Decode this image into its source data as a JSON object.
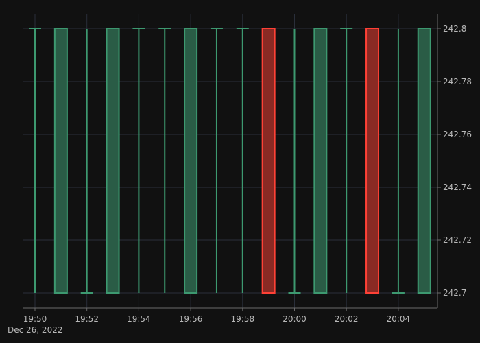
{
  "colors": {
    "background": "#111111",
    "grid": "#2a2f3a",
    "axis": "#6a6a6a",
    "increasing": "#3d9970",
    "increasing_fill": "#2a5c46",
    "decreasing": "#ff4136",
    "decreasing_fill": "#8a2a24",
    "text": "#b8b8b8"
  },
  "chart_data": {
    "type": "candlestick",
    "x_ticks": [
      "19:50",
      "19:52",
      "19:54",
      "19:56",
      "19:58",
      "20:00",
      "20:02",
      "20:04"
    ],
    "x_date_label": "Dec 26, 2022",
    "y_ticks": [
      "242.7",
      "242.72",
      "242.74",
      "242.76",
      "242.78",
      "242.8"
    ],
    "ylim": [
      242.7,
      242.8
    ],
    "xlim": [
      "19:49.5",
      "20:05.3"
    ],
    "candles": [
      {
        "t": "19:50",
        "open": 242.8,
        "high": 242.8,
        "low": 242.7,
        "close": 242.8
      },
      {
        "t": "19:51",
        "open": 242.7,
        "high": 242.8,
        "low": 242.7,
        "close": 242.8
      },
      {
        "t": "19:52",
        "open": 242.7,
        "high": 242.8,
        "low": 242.7,
        "close": 242.7
      },
      {
        "t": "19:53",
        "open": 242.7,
        "high": 242.8,
        "low": 242.7,
        "close": 242.8
      },
      {
        "t": "19:54",
        "open": 242.8,
        "high": 242.8,
        "low": 242.7,
        "close": 242.8
      },
      {
        "t": "19:55",
        "open": 242.8,
        "high": 242.8,
        "low": 242.7,
        "close": 242.8
      },
      {
        "t": "19:56",
        "open": 242.7,
        "high": 242.8,
        "low": 242.7,
        "close": 242.8
      },
      {
        "t": "19:57",
        "open": 242.8,
        "high": 242.8,
        "low": 242.7,
        "close": 242.8
      },
      {
        "t": "19:58",
        "open": 242.8,
        "high": 242.8,
        "low": 242.7,
        "close": 242.8
      },
      {
        "t": "19:59",
        "open": 242.8,
        "high": 242.8,
        "low": 242.7,
        "close": 242.7
      },
      {
        "t": "20:00",
        "open": 242.7,
        "high": 242.8,
        "low": 242.7,
        "close": 242.7
      },
      {
        "t": "20:01",
        "open": 242.7,
        "high": 242.8,
        "low": 242.7,
        "close": 242.8
      },
      {
        "t": "20:02",
        "open": 242.8,
        "high": 242.8,
        "low": 242.7,
        "close": 242.8
      },
      {
        "t": "20:03",
        "open": 242.8,
        "high": 242.8,
        "low": 242.7,
        "close": 242.7
      },
      {
        "t": "20:04",
        "open": 242.7,
        "high": 242.8,
        "low": 242.7,
        "close": 242.7
      },
      {
        "t": "20:05",
        "open": 242.7,
        "high": 242.8,
        "low": 242.7,
        "close": 242.8
      }
    ]
  }
}
